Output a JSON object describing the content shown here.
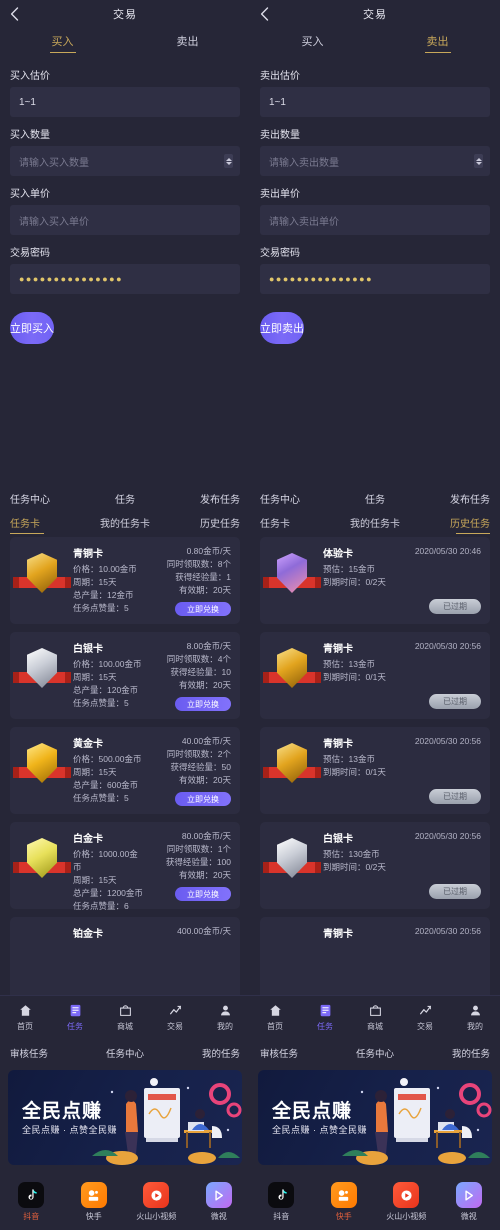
{
  "trade": {
    "left": {
      "back_icon": "chevron-left-icon",
      "title": "交易",
      "tabs": [
        {
          "label": "买入",
          "active": true
        },
        {
          "label": "卖出",
          "active": false
        }
      ],
      "fields": [
        {
          "label": "买入估价",
          "value": "1~1",
          "placeholder": "",
          "stepper": false
        },
        {
          "label": "买入数量",
          "value": "",
          "placeholder": "请输入买入数量",
          "stepper": true
        },
        {
          "label": "买入单价",
          "value": "",
          "placeholder": "请输入买入单价",
          "stepper": false
        },
        {
          "label": "交易密码",
          "value": "●●●●●●●●●●●●●●●",
          "placeholder": "",
          "stepper": false
        }
      ],
      "cta": "立即买入"
    },
    "right": {
      "back_icon": "chevron-left-icon",
      "title": "交易",
      "tabs": [
        {
          "label": "买入",
          "active": false
        },
        {
          "label": "卖出",
          "active": true
        }
      ],
      "fields": [
        {
          "label": "卖出估价",
          "value": "1~1",
          "placeholder": "",
          "stepper": false
        },
        {
          "label": "卖出数量",
          "value": "",
          "placeholder": "请输入卖出数量",
          "stepper": true
        },
        {
          "label": "卖出单价",
          "value": "",
          "placeholder": "请输入卖出单价",
          "stepper": false
        },
        {
          "label": "交易密码",
          "value": "●●●●●●●●●●●●●●●",
          "placeholder": "",
          "stepper": false
        }
      ],
      "cta": "立即卖出"
    }
  },
  "task_center": {
    "header": [
      "任务中心",
      "任务",
      "发布任务"
    ],
    "left": {
      "tabs": [
        {
          "label": "任务卡",
          "active": true
        },
        {
          "label": "我的任务卡",
          "active": false
        },
        {
          "label": "历史任务",
          "active": false
        }
      ],
      "cards": [
        {
          "name": "青铜卡",
          "shield": "bronze",
          "price": "价格：10.00金币",
          "cycle": "周期：15天",
          "total": "总产量：12金币",
          "likes": "任务点赞量：5",
          "rate": "0.80金币/天",
          "concurrent": "同时领取数：8个",
          "exp": "获得经验量：1",
          "valid": "有效期：20天",
          "button": "立即兑换"
        },
        {
          "name": "白银卡",
          "shield": "silver",
          "price": "价格：100.00金币",
          "cycle": "周期：15天",
          "total": "总产量：120金币",
          "likes": "任务点赞量：5",
          "rate": "8.00金币/天",
          "concurrent": "同时领取数：4个",
          "exp": "获得经验量：10",
          "valid": "有效期：20天",
          "button": "立即兑换"
        },
        {
          "name": "黄金卡",
          "shield": "gold",
          "price": "价格：500.00金币",
          "cycle": "周期：15天",
          "total": "总产量：600金币",
          "likes": "任务点赞量：5",
          "rate": "40.00金币/天",
          "concurrent": "同时领取数：2个",
          "exp": "获得经验量：50",
          "valid": "有效期：20天",
          "button": "立即兑换"
        },
        {
          "name": "白金卡",
          "shield": "plat",
          "price": "价格：1000.00金币",
          "cycle": "周期：15天",
          "total": "总产量：1200金币",
          "likes": "任务点赞量：6",
          "rate": "80.00金币/天",
          "concurrent": "同时领取数：1个",
          "exp": "获得经验量：100",
          "valid": "有效期：20天",
          "button": "立即兑换"
        },
        {
          "name": "铂金卡",
          "shield": "plat",
          "price": "",
          "cycle": "",
          "total": "",
          "likes": "",
          "rate": "400.00金币/天",
          "concurrent": "",
          "exp": "",
          "valid": "",
          "button": ""
        }
      ]
    },
    "right": {
      "tabs": [
        {
          "label": "任务卡",
          "active": false
        },
        {
          "label": "我的任务卡",
          "active": false
        },
        {
          "label": "历史任务",
          "active": true
        }
      ],
      "cards": [
        {
          "name": "体验卡",
          "shield": "exp",
          "estimate": "预估：15金币",
          "expire": "到期时间：0/2天",
          "time": "2020/05/30 20:46",
          "status": "已过期"
        },
        {
          "name": "青铜卡",
          "shield": "bronze",
          "estimate": "预估：13金币",
          "expire": "到期时间：0/1天",
          "time": "2020/05/30 20:56",
          "status": "已过期"
        },
        {
          "name": "青铜卡",
          "shield": "bronze",
          "estimate": "预估：13金币",
          "expire": "到期时间：0/1天",
          "time": "2020/05/30 20:56",
          "status": "已过期"
        },
        {
          "name": "白银卡",
          "shield": "silver",
          "estimate": "预估：130金币",
          "expire": "到期时间：0/2天",
          "time": "2020/05/30 20:56",
          "status": "已过期"
        },
        {
          "name": "青铜卡",
          "shield": "bronze",
          "estimate": "",
          "expire": "",
          "time": "2020/05/30 20:56",
          "status": ""
        }
      ]
    }
  },
  "bottom_nav": {
    "items": [
      {
        "label": "首页",
        "icon": "home-icon",
        "active": false
      },
      {
        "label": "任务",
        "icon": "task-list-icon",
        "active": true
      },
      {
        "label": "商城",
        "icon": "shop-bag-icon",
        "active": false
      },
      {
        "label": "交易",
        "icon": "trend-chart-icon",
        "active": false
      },
      {
        "label": "我的",
        "icon": "person-icon",
        "active": false
      }
    ]
  },
  "sub_tabs": [
    "审核任务",
    "任务中心",
    "我的任务"
  ],
  "banner": {
    "title": "全民点赚",
    "subtitle": "全民点赚 · 点赞全民赚",
    "art": "illustration-people-whiteboard"
  },
  "apps": {
    "left_active_index": 0,
    "right_active_index": 1,
    "items": [
      {
        "label": "抖音",
        "icon": "douyin-note-icon"
      },
      {
        "label": "快手",
        "icon": "kuaishou-icon"
      },
      {
        "label": "火山小视频",
        "icon": "huoshan-play-icon"
      },
      {
        "label": "微视",
        "icon": "weishi-play-icon"
      }
    ]
  },
  "colors": {
    "page_bg": "#1b1b2b",
    "panel_bg": "#262637",
    "card_bg": "#2c2c40",
    "input_bg": "#2f2f44",
    "accent_purple": "#7b6af7",
    "accent_gold": "#c8a85a",
    "text_primary": "#e8e8f0",
    "text_muted": "#b9b9cb",
    "expired_gray": "#9aa0ad",
    "app_active": "#e2603c"
  }
}
